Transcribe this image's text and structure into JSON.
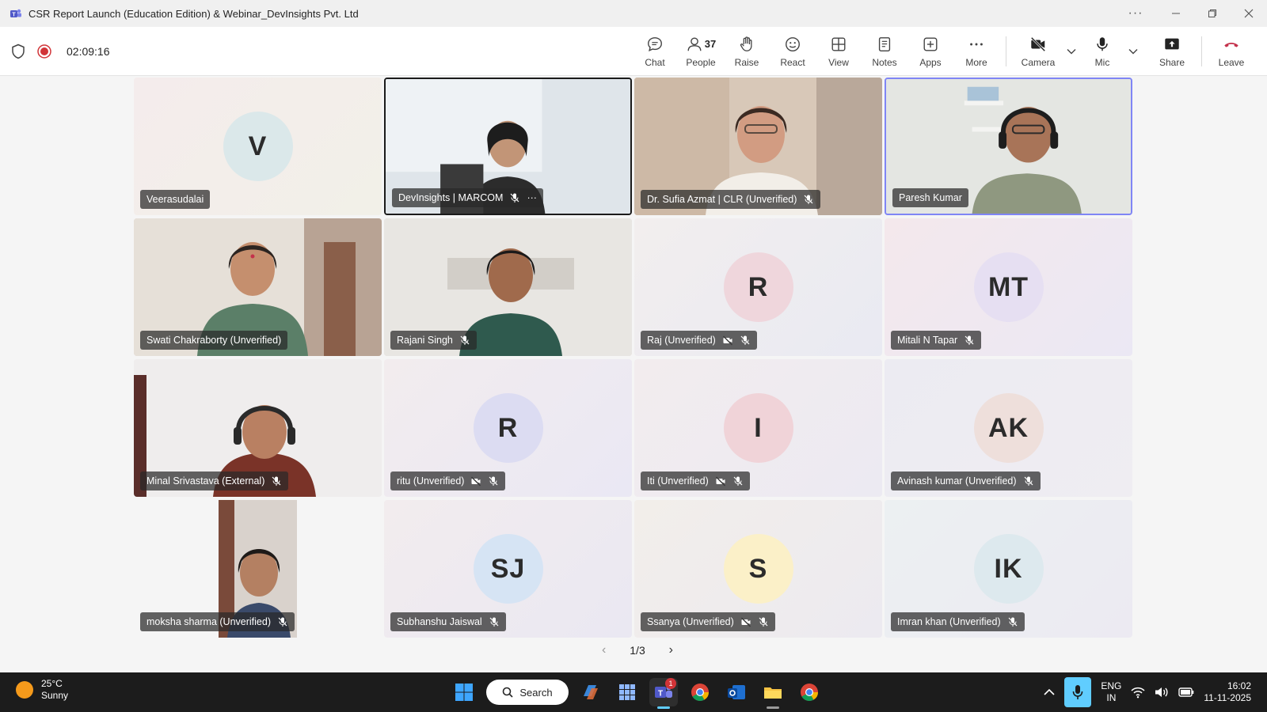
{
  "window": {
    "title": "CSR Report Launch (Education Edition) & Webinar_DevInsights Pvt. Ltd",
    "more_glyph": "···"
  },
  "toolbar": {
    "timer": "02:09:16",
    "chat": "Chat",
    "people": "People",
    "people_count": "37",
    "raise": "Raise",
    "react": "React",
    "view": "View",
    "notes": "Notes",
    "apps": "Apps",
    "more": "More",
    "camera": "Camera",
    "mic": "Mic",
    "share": "Share",
    "leave": "Leave"
  },
  "tiles": [
    {
      "name": "Veerasudalai",
      "initials": "V",
      "avatar_color": "#dbe8ea"
    },
    {
      "name": "DevInsights | MARCOM",
      "more": "···"
    },
    {
      "name": "Dr. Sufia Azmat | CLR (Unverified)"
    },
    {
      "name": "Paresh Kumar"
    },
    {
      "name": "Swati Chakraborty (Unverified)"
    },
    {
      "name": "Rajani Singh"
    },
    {
      "name": "Raj (Unverified)",
      "initials": "R",
      "avatar_color": "#efd6dc"
    },
    {
      "name": "Mitali N Tapar",
      "initials": "MT",
      "avatar_color": "#e6dff2"
    },
    {
      "name": "Minal Srivastava (External)"
    },
    {
      "name": "ritu (Unverified)",
      "initials": "R",
      "avatar_color": "#dcdcf2"
    },
    {
      "name": "Iti (Unverified)",
      "initials": "I",
      "avatar_color": "#f0d3d8"
    },
    {
      "name": "Avinash kumar (Unverified)",
      "initials": "AK",
      "avatar_color": "#eedfdb"
    },
    {
      "name": "moksha sharma (Unverified)"
    },
    {
      "name": "Subhanshu Jaiswal",
      "initials": "SJ",
      "avatar_color": "#d6e4f4"
    },
    {
      "name": "Ssanya (Unverified)",
      "initials": "S",
      "avatar_color": "#fbf0c8"
    },
    {
      "name": "Imran khan (Unverified)",
      "initials": "IK",
      "avatar_color": "#dde9ee"
    }
  ],
  "pager": {
    "label": "1/3",
    "prev": "‹",
    "next": "›"
  },
  "taskbar": {
    "temperature": "25°C",
    "condition": "Sunny",
    "search": "Search",
    "teams_badge": "1",
    "lang_top": "ENG",
    "lang_bottom": "IN",
    "time": "16:02",
    "date": "11-11-2025"
  },
  "colors": {
    "leave_red": "#c4314b",
    "accent": "#7f85f5",
    "record_red": "#d13438",
    "taskbar_bg": "#1c1c1c",
    "tray_accent": "#60cdff"
  }
}
